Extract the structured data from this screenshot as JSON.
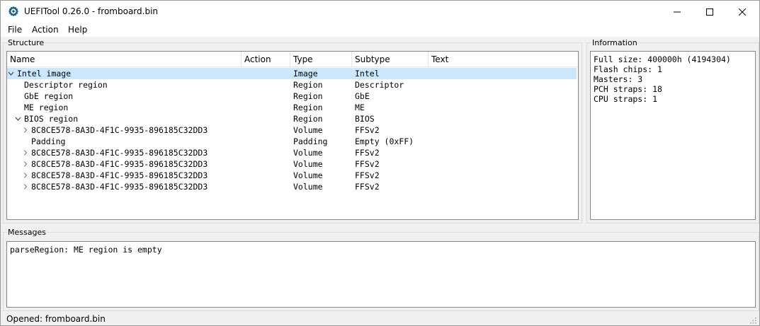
{
  "window": {
    "title": "UEFITool 0.26.0 - fromboard.bin",
    "app_icon": "uefitool-gear-icon",
    "controls": [
      "minimize-icon",
      "maximize-icon",
      "close-icon"
    ]
  },
  "menu": [
    "File",
    "Action",
    "Help"
  ],
  "structure": {
    "label": "Structure",
    "columns": [
      "Name",
      "Action",
      "Type",
      "Subtype",
      "Text"
    ],
    "rows": [
      {
        "arrow": "expanded",
        "name": "Intel image",
        "action": "",
        "type": "Image",
        "subtype": "Intel",
        "text": "",
        "selected": true,
        "indent": 0
      },
      {
        "arrow": "none",
        "name": "Descriptor region",
        "action": "",
        "type": "Region",
        "subtype": "Descriptor",
        "text": "",
        "selected": false,
        "indent": 1
      },
      {
        "arrow": "none",
        "name": "GbE region",
        "action": "",
        "type": "Region",
        "subtype": "GbE",
        "text": "",
        "selected": false,
        "indent": 1
      },
      {
        "arrow": "none",
        "name": "ME region",
        "action": "",
        "type": "Region",
        "subtype": "ME",
        "text": "",
        "selected": false,
        "indent": 1
      },
      {
        "arrow": "expanded",
        "name": "BIOS region",
        "action": "",
        "type": "Region",
        "subtype": "BIOS",
        "text": "",
        "selected": false,
        "indent": 1
      },
      {
        "arrow": "collapsed",
        "name": "8C8CE578-8A3D-4F1C-9935-896185C32DD3",
        "action": "",
        "type": "Volume",
        "subtype": "FFSv2",
        "text": "",
        "selected": false,
        "indent": 2
      },
      {
        "arrow": "none",
        "name": "Padding",
        "action": "",
        "type": "Padding",
        "subtype": "Empty (0xFF)",
        "text": "",
        "selected": false,
        "indent": 2
      },
      {
        "arrow": "collapsed",
        "name": "8C8CE578-8A3D-4F1C-9935-896185C32DD3",
        "action": "",
        "type": "Volume",
        "subtype": "FFSv2",
        "text": "",
        "selected": false,
        "indent": 2
      },
      {
        "arrow": "collapsed",
        "name": "8C8CE578-8A3D-4F1C-9935-896185C32DD3",
        "action": "",
        "type": "Volume",
        "subtype": "FFSv2",
        "text": "",
        "selected": false,
        "indent": 2
      },
      {
        "arrow": "collapsed",
        "name": "8C8CE578-8A3D-4F1C-9935-896185C32DD3",
        "action": "",
        "type": "Volume",
        "subtype": "FFSv2",
        "text": "",
        "selected": false,
        "indent": 2
      },
      {
        "arrow": "collapsed",
        "name": "8C8CE578-8A3D-4F1C-9935-896185C32DD3",
        "action": "",
        "type": "Volume",
        "subtype": "FFSv2",
        "text": "",
        "selected": false,
        "indent": 2
      }
    ]
  },
  "information": {
    "label": "Information",
    "lines": [
      "Full size: 400000h (4194304)",
      "Flash chips: 1",
      "Masters: 3",
      "PCH straps: 18",
      "CPU straps: 1"
    ]
  },
  "messages": {
    "label": "Messages",
    "lines": [
      "parseRegion: ME region is empty"
    ]
  },
  "status_bar": "Opened: fromboard.bin",
  "colors": {
    "selection": "#cce8ff",
    "window_bg": "#f0f0f0",
    "panel_border": "#828790"
  }
}
